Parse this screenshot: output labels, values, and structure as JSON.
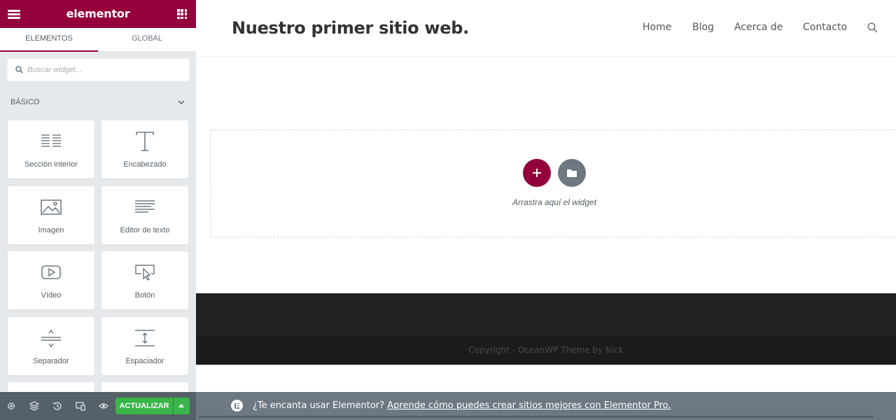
{
  "panel": {
    "header": {
      "logo": "elementor"
    },
    "tabs": [
      {
        "label": "ELEMENTOS",
        "active": true
      },
      {
        "label": "GLOBAL",
        "active": false
      }
    ],
    "search": {
      "placeholder": "Buscar widget...",
      "value": ""
    },
    "category": {
      "title": "BÁSICO"
    },
    "widgets": [
      {
        "label": "Sección interior",
        "icon": "inner-section-icon"
      },
      {
        "label": "Encabezado",
        "icon": "heading-icon"
      },
      {
        "label": "Imagen",
        "icon": "image-icon"
      },
      {
        "label": "Editor de texto",
        "icon": "text-editor-icon"
      },
      {
        "label": "Vídeo",
        "icon": "video-icon"
      },
      {
        "label": "Botón",
        "icon": "button-icon"
      },
      {
        "label": "Separador",
        "icon": "divider-icon"
      },
      {
        "label": "Espaciador",
        "icon": "spacer-icon"
      }
    ],
    "footer": {
      "icons": [
        "settings-icon",
        "navigator-icon",
        "history-icon",
        "responsive-icon",
        "preview-icon"
      ],
      "update_label": "ACTUALIZAR"
    }
  },
  "site": {
    "title": "Nuestro primer sitio web.",
    "nav": [
      "Home",
      "Blog",
      "Acerca de",
      "Contacto"
    ],
    "dropzone_text": "Arrastra aquí el widget",
    "copyright": "Copyright - OceanWP Theme by Nick"
  },
  "notice": {
    "text": "¿Te encanta usar Elementor?",
    "link": "Aprende cómo puedes crear sitios mejores con Elementor Pro."
  },
  "colors": {
    "brand": "#93003c",
    "panel_bg": "#e6e9ec",
    "update_green": "#39b54a",
    "footer_dark": "#222222",
    "notice_bg": "#6d7882"
  }
}
